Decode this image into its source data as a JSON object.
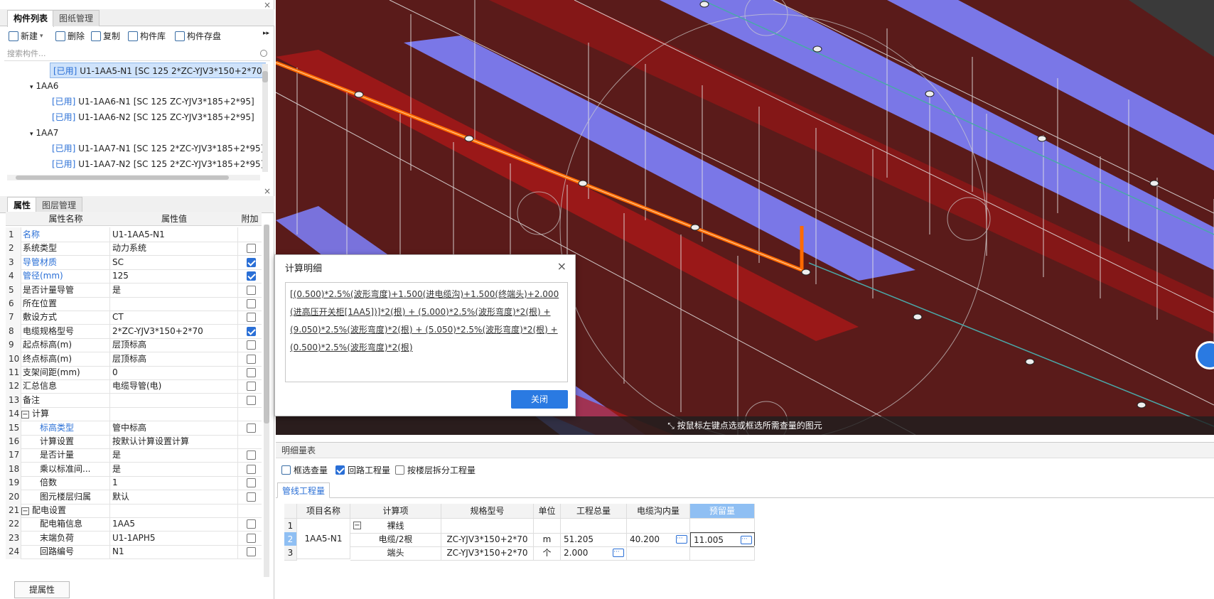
{
  "left_top": {
    "tabs": [
      "构件列表",
      "图纸管理"
    ],
    "close": "×",
    "toolbar": {
      "new": "新建",
      "delete": "删除",
      "copy": "复制",
      "lib": "构件库",
      "save": "构件存盘",
      "more": "▸▸"
    },
    "search_placeholder": "搜索构件...",
    "tree": [
      {
        "tag": "[已用]",
        "text": "U1-1AA5-N1 [SC 125 2*ZC-YJV3*150+2*70]",
        "selected": true
      },
      {
        "group": "1AA6"
      },
      {
        "tag": "[已用]",
        "text": "U1-1AA6-N1 [SC 125 ZC-YJV3*185+2*95]"
      },
      {
        "tag": "[已用]",
        "text": "U1-1AA6-N2 [SC 125 ZC-YJV3*185+2*95]"
      },
      {
        "group": "1AA7"
      },
      {
        "tag": "[已用]",
        "text": "U1-1AA7-N1 [SC 125 2*ZC-YJV3*185+2*95]"
      },
      {
        "tag": "[已用]",
        "text": "U1-1AA7-N2 [SC 125 2*ZC-YJV3*185+2*95]"
      }
    ]
  },
  "props": {
    "tabs": [
      "属性",
      "图层管理"
    ],
    "headers": [
      "属性名称",
      "属性值",
      "附加"
    ],
    "rows": [
      {
        "n": "1",
        "name": "名称",
        "value": "U1-1AA5-N1",
        "blue": true,
        "cb": null
      },
      {
        "n": "2",
        "name": "系统类型",
        "value": "动力系统",
        "cb": false
      },
      {
        "n": "3",
        "name": "导管材质",
        "value": "SC",
        "blue": true,
        "cb": true
      },
      {
        "n": "4",
        "name": "管径(mm)",
        "value": "125",
        "blue": true,
        "cb": true
      },
      {
        "n": "5",
        "name": "是否计量导管",
        "value": "是",
        "cb": false
      },
      {
        "n": "6",
        "name": "所在位置",
        "value": "",
        "cb": false
      },
      {
        "n": "7",
        "name": "敷设方式",
        "value": "CT",
        "cb": false
      },
      {
        "n": "8",
        "name": "电缆规格型号",
        "value": "2*ZC-YJV3*150+2*70",
        "cb": true
      },
      {
        "n": "9",
        "name": "起点标高(m)",
        "value": "层顶标高",
        "cb": false
      },
      {
        "n": "10",
        "name": "终点标高(m)",
        "value": "层顶标高",
        "cb": false
      },
      {
        "n": "11",
        "name": "支架间距(mm)",
        "value": "0",
        "cb": false
      },
      {
        "n": "12",
        "name": "汇总信息",
        "value": "电缆导管(电)",
        "cb": false
      },
      {
        "n": "13",
        "name": "备注",
        "value": "",
        "cb": false
      },
      {
        "n": "14",
        "name": "计算",
        "value": "",
        "group": true,
        "cb": null
      },
      {
        "n": "15",
        "name": "标高类型",
        "value": "管中标高",
        "blue": true,
        "indent": true,
        "cb": false
      },
      {
        "n": "16",
        "name": "计算设置",
        "value": "按默认计算设置计算",
        "indent": true,
        "cb": null
      },
      {
        "n": "17",
        "name": "是否计量",
        "value": "是",
        "indent": true,
        "cb": false
      },
      {
        "n": "18",
        "name": "乘以标准间...",
        "value": "是",
        "indent": true,
        "cb": false
      },
      {
        "n": "19",
        "name": "倍数",
        "value": "1",
        "indent": true,
        "cb": false
      },
      {
        "n": "20",
        "name": "图元楼层归属",
        "value": "默认",
        "indent": true,
        "cb": false
      },
      {
        "n": "21",
        "name": "配电设置",
        "value": "",
        "group": true,
        "cb": null
      },
      {
        "n": "22",
        "name": "配电箱信息",
        "value": "1AA5",
        "indent": true,
        "cb": false
      },
      {
        "n": "23",
        "name": "末端负荷",
        "value": "U1-1APH5",
        "indent": true,
        "cb": false
      },
      {
        "n": "24",
        "name": "回路编号",
        "value": "N1",
        "indent": true,
        "cb": false
      }
    ],
    "bottom_button": "提属性"
  },
  "view": {
    "hint": "按鼠标左键点选或框选所需查量的图元"
  },
  "dialog": {
    "title": "计算明细",
    "close": "×",
    "formula": "[(0.500)*2.5%(波形弯度)+1.500(进电缆沟)+1.500(终端头)+2.000(进高压开关柜[1AA5])]*2(根) + (5.000)*2.5%(波形弯度)*2(根) + (9.050)*2.5%(波形弯度)*2(根) + (5.050)*2.5%(波形弯度)*2(根) + (0.500)*2.5%(波形弯度)*2(根)",
    "ok": "关闭"
  },
  "qty": {
    "header": "明细量表",
    "opt_select": "框选查量",
    "opt_loop": "回路工程量",
    "opt_floor": "按楼层拆分工程量",
    "subtab": "管线工程量",
    "cols": [
      "项目名称",
      "计算项",
      "规格型号",
      "单位",
      "工程总量",
      "电缆沟内量",
      "预留量"
    ],
    "rows": [
      {
        "n": "1",
        "project": "",
        "item": "裸线",
        "spec": "",
        "unit": "",
        "total": "",
        "trench": "",
        "reserve": ""
      },
      {
        "n": "2",
        "project": "1AA5-N1",
        "item": "电缆/2根",
        "spec": "ZC-YJV3*150+2*70",
        "unit": "m",
        "total": "51.205",
        "trench": "40.200",
        "reserve": "11.005"
      },
      {
        "n": "3",
        "project": "",
        "item": "端头",
        "spec": "ZC-YJV3*150+2*70",
        "unit": "个",
        "total": "2.000",
        "trench": "",
        "reserve": ""
      }
    ],
    "dots": "···",
    "minus": "−"
  }
}
